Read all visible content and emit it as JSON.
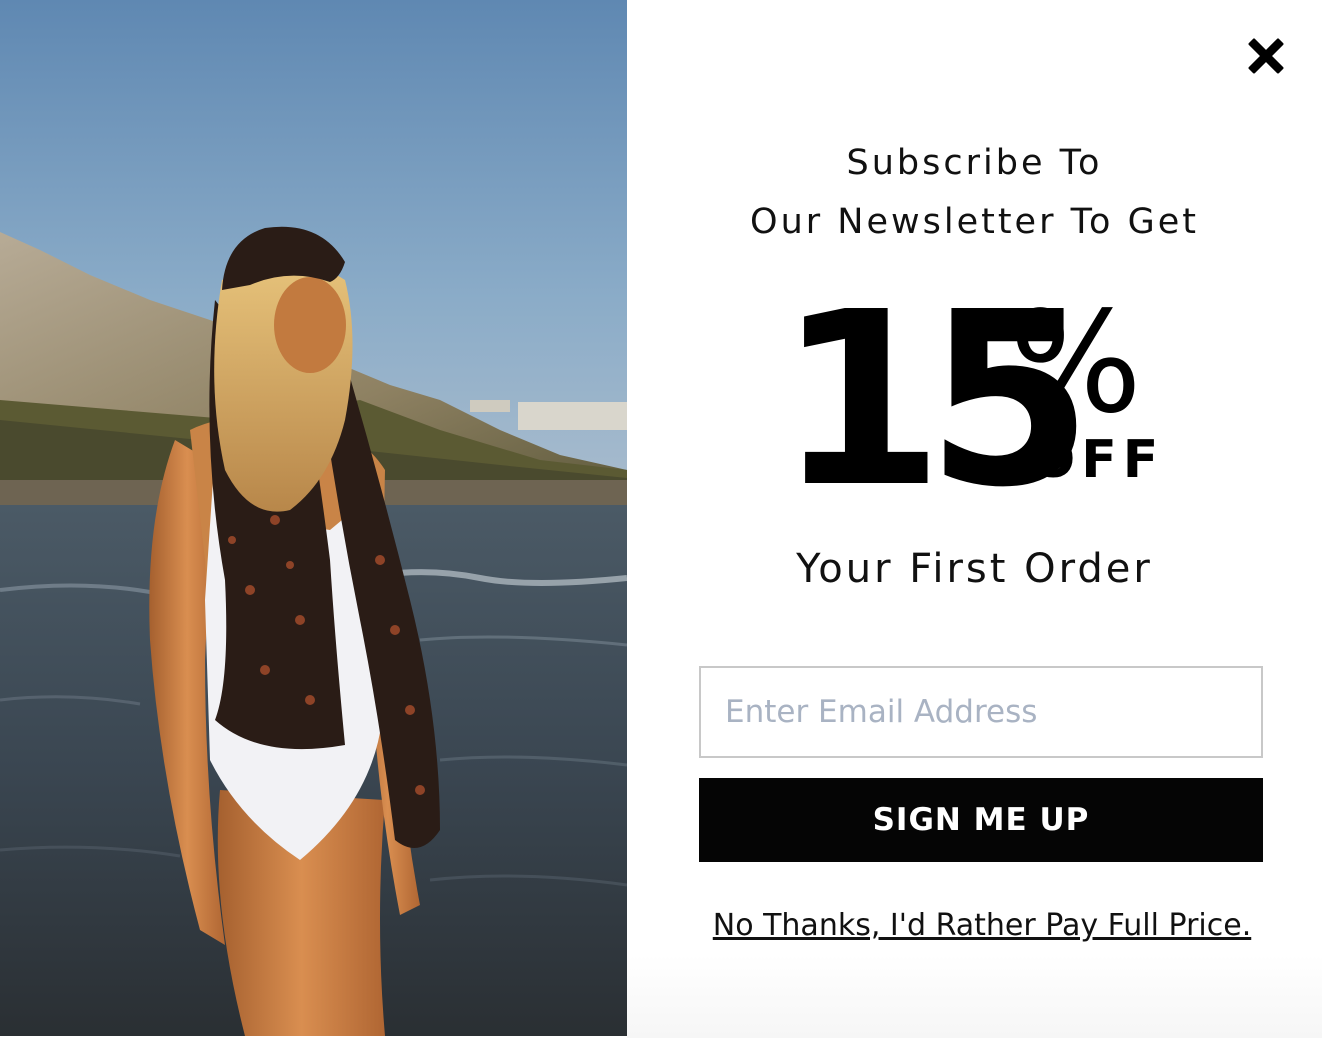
{
  "popup": {
    "image": {
      "alt": "Model on beach wearing white swimsuit and printed scarf"
    },
    "close": {
      "icon": "close-icon"
    },
    "headline": {
      "line1": "Subscribe To",
      "line2": "Our Newsletter To Get",
      "line3": "Your First Order"
    },
    "discount": {
      "number": "15",
      "percent_sign": "%",
      "off_label": "OFF"
    },
    "form": {
      "email_placeholder": "Enter Email Address",
      "email_value": "",
      "submit_label": "SIGN ME UP"
    },
    "decline_label": "No Thanks, I'd Rather Pay Full Price.",
    "colors": {
      "button_bg": "#050505",
      "button_text": "#ffffff",
      "placeholder": "#a9b3c3",
      "text": "#111111"
    }
  }
}
